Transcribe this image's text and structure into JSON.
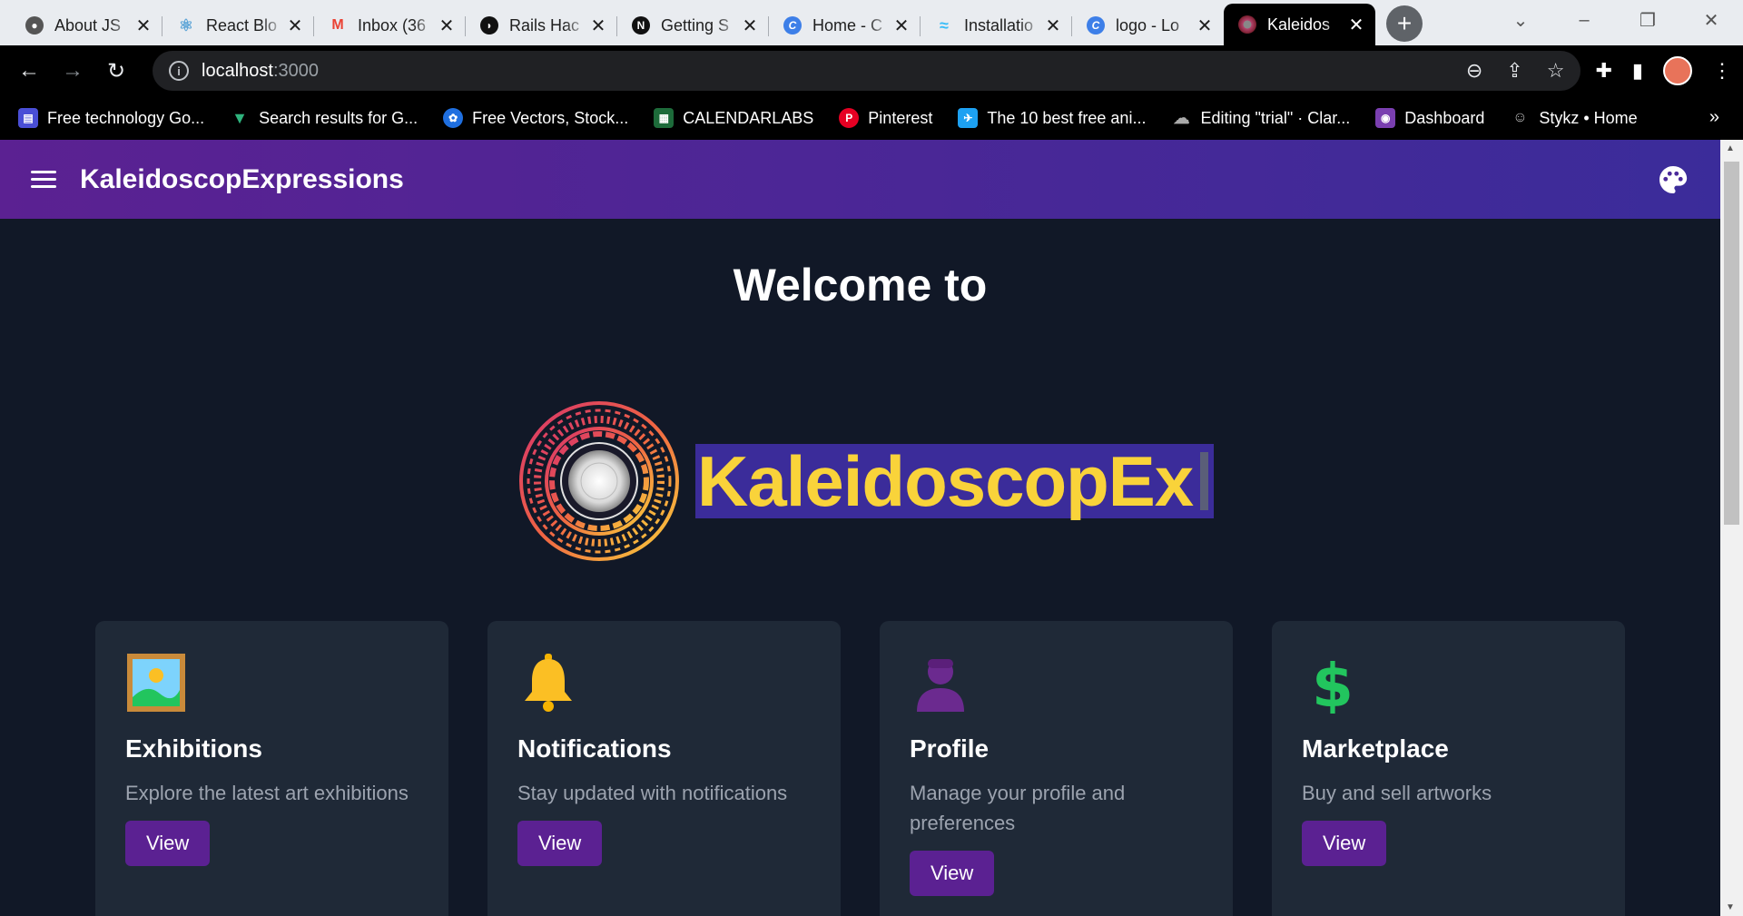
{
  "browser": {
    "tabs": [
      {
        "title": "About JS",
        "favicon": "github-icon",
        "color": "#555555"
      },
      {
        "title": "React Blo",
        "favicon": "react-icon",
        "color": "#5aa3d6"
      },
      {
        "title": "Inbox (36",
        "favicon": "gmail-icon",
        "color": "#ea4335"
      },
      {
        "title": "Rails Hac",
        "favicon": "rails-icon",
        "color": "#111111"
      },
      {
        "title": "Getting S",
        "favicon": "notion-icon",
        "color": "#111111"
      },
      {
        "title": "Home - C",
        "favicon": "canva-icon",
        "color": "#3d7fe8"
      },
      {
        "title": "Installatio",
        "favicon": "tailwind-icon",
        "color": "#38bdf8"
      },
      {
        "title": "logo - Lo",
        "favicon": "canva-icon",
        "color": "#3d7fe8"
      },
      {
        "title": "Kaleidos",
        "favicon": "kaleidoscope-icon",
        "color": "#b5446e"
      }
    ],
    "active_tab": 8,
    "url_host": "localhost",
    "url_port": ":3000",
    "bookmarks": [
      {
        "label": "Free technology Go...",
        "icon": "bookmark-tech-icon",
        "color": "#4a4fd6"
      },
      {
        "label": "Search results for G...",
        "icon": "vue-icon",
        "color": "#2fb37d"
      },
      {
        "label": "Free Vectors, Stock...",
        "icon": "freepik-icon",
        "color": "#1f6fe0"
      },
      {
        "label": "CALENDARLABS",
        "icon": "calendarlabs-icon",
        "color": "#1d6b3a"
      },
      {
        "label": "Pinterest",
        "icon": "pinterest-icon",
        "color": "#e60023"
      },
      {
        "label": "The 10 best free ani...",
        "icon": "bird-icon",
        "color": "#1da1f2"
      },
      {
        "label": "Editing \"trial\" · Clar...",
        "icon": "cloud-icon",
        "color": "#777777"
      },
      {
        "label": "Dashboard",
        "icon": "dashboard-icon",
        "color": "#7a3fb0"
      },
      {
        "label": "Stykz • Home",
        "icon": "stykz-icon",
        "color": "#555555"
      }
    ]
  },
  "app": {
    "brand": "KaleidoscopExpressions",
    "welcome": "Welcome to",
    "typed_text": "KaleidoscopEx",
    "colors": {
      "purple": "#5b2192",
      "indigo": "#3b2c9a",
      "yellow": "#f9d33a",
      "bg": "#111827",
      "card": "#1f2937"
    },
    "cards": [
      {
        "title": "Exhibitions",
        "desc": "Explore the latest art exhibitions",
        "button": "View",
        "icon": "framed-picture-icon"
      },
      {
        "title": "Notifications",
        "desc": "Stay updated with notifications",
        "button": "View",
        "icon": "bell-icon"
      },
      {
        "title": "Profile",
        "desc": "Manage your profile and preferences",
        "button": "View",
        "icon": "user-icon"
      },
      {
        "title": "Marketplace",
        "desc": "Buy and sell artworks",
        "button": "View",
        "icon": "dollar-icon"
      }
    ]
  }
}
